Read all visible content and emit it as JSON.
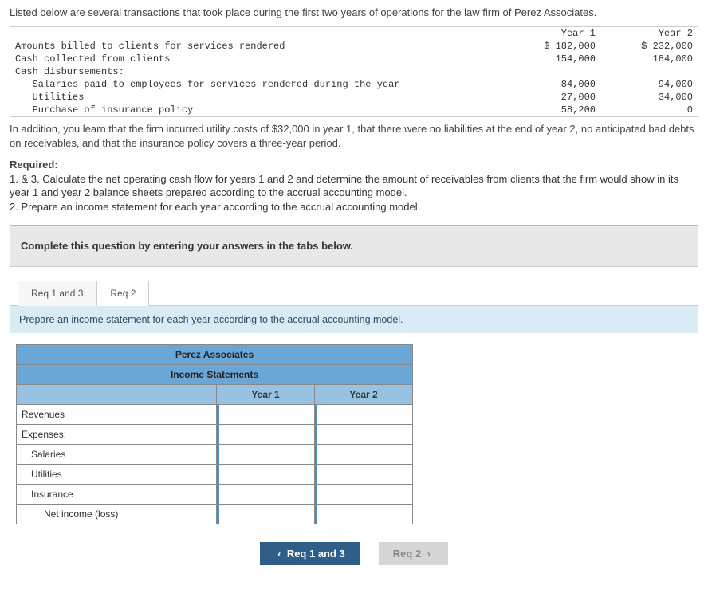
{
  "intro": "Listed below are several transactions that took place during the first two years of operations for the law firm of Perez Associates.",
  "table": {
    "col1": "Year 1",
    "col2": "Year 2",
    "rows": [
      {
        "label": "Amounts billed to clients for services rendered",
        "y1": "$ 182,000",
        "y2": "$ 232,000"
      },
      {
        "label": "Cash collected from clients",
        "y1": "154,000",
        "y2": "184,000"
      },
      {
        "label": "Cash disbursements:",
        "y1": "",
        "y2": ""
      },
      {
        "label": "   Salaries paid to employees for services rendered during the year",
        "y1": "84,000",
        "y2": "94,000"
      },
      {
        "label": "   Utilities",
        "y1": "27,000",
        "y2": "34,000"
      },
      {
        "label": "   Purchase of insurance policy",
        "y1": "58,200",
        "y2": "0"
      }
    ]
  },
  "after": "In addition, you learn that the firm incurred utility costs of $32,000 in year 1, that there were no liabilities at the end of year 2, no anticipated bad debts on receivables, and that the insurance policy covers a three-year period.",
  "required": {
    "title": "Required:",
    "line1": "1. & 3. Calculate the net operating cash flow for years 1 and 2 and determine the amount of receivables from clients that the firm would show in its year 1 and year 2 balance sheets prepared according to the accrual accounting model.",
    "line2": "2. Prepare an income statement for each year according to the accrual accounting model."
  },
  "instruction": "Complete this question by entering your answers in the tabs below.",
  "tabs": {
    "t1": "Req 1 and 3",
    "t2": "Req 2"
  },
  "tab_note": "Prepare an income statement for each year according to the accrual accounting model.",
  "income": {
    "header1": "Perez Associates",
    "header2": "Income Statements",
    "col1": "Year 1",
    "col2": "Year 2",
    "rows": {
      "r1": "Revenues",
      "r2": "Expenses:",
      "r3": "Salaries",
      "r4": "Utilities",
      "r5": "Insurance",
      "r6": "Net income (loss)"
    }
  },
  "nav": {
    "prev": "Req 1 and 3",
    "next": "Req 2"
  }
}
